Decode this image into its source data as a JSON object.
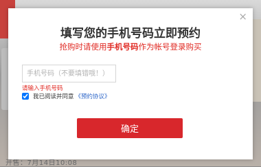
{
  "dialog": {
    "close_glyph": "×",
    "title": "填写您的手机号码立即预约",
    "subtitle_prefix": "抢购时请使用",
    "subtitle_bold": "手机号码",
    "subtitle_suffix": "作为帐号登录购买",
    "phone_placeholder": "手机号码（不要填错哦！）",
    "phone_value": "",
    "error_text": "请输入手机号码",
    "agree_checked": true,
    "agree_text": "我已阅读并同意",
    "agree_link": "《预约协议》",
    "confirm_label": "确定"
  },
  "background": {
    "partial_text": "开售：7月14日10:08"
  },
  "colors": {
    "accent": "#d8272c",
    "error": "#e02a23",
    "link": "#2a64c8"
  }
}
